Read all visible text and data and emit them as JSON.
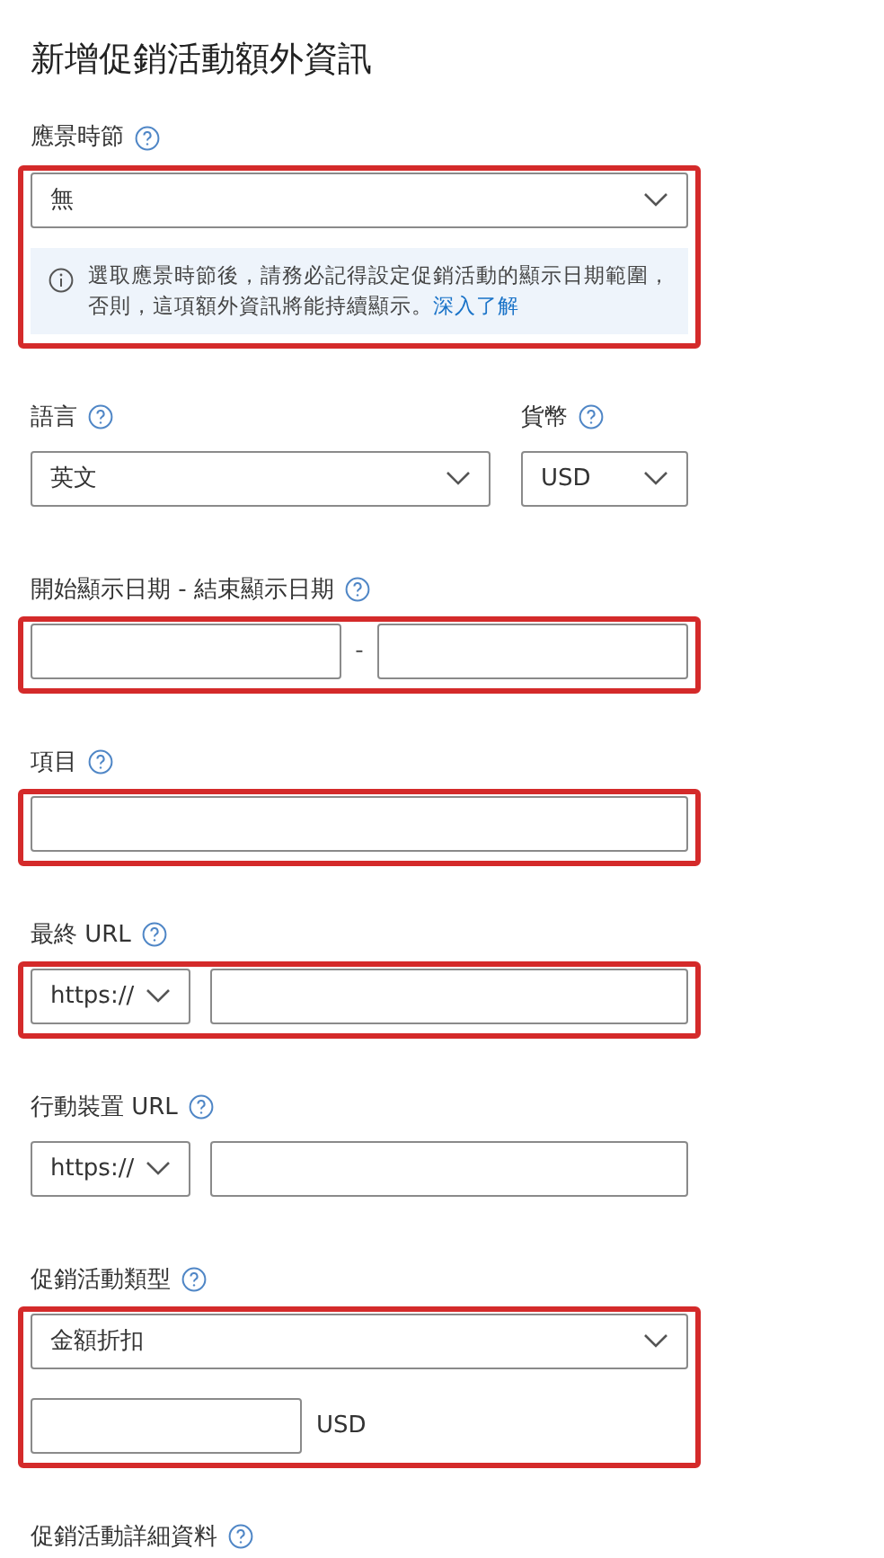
{
  "title": "新增促銷活動額外資訊",
  "groups": [
    {
      "kind": "select",
      "label": "應景時節",
      "value": "無",
      "highlighted": true,
      "note": {
        "text": "選取應景時節後，請務必記得設定促銷活動的顯示日期範圍，否則，這項額外資訊將能持續顯示。",
        "link": "深入了解"
      }
    },
    {
      "kind": "pair",
      "highlighted": false,
      "items": [
        {
          "label": "語言",
          "value": "英文"
        },
        {
          "label": "貨幣",
          "value": "USD"
        }
      ]
    },
    {
      "kind": "date-range",
      "label": "開始顯示日期 - 結束顯示日期",
      "separator": "-",
      "highlighted": true
    },
    {
      "kind": "text",
      "label": "項目",
      "highlighted": true
    },
    {
      "kind": "url",
      "label": "最終 URL",
      "protocol": "https://",
      "highlighted": true
    },
    {
      "kind": "url",
      "label": "行動裝置 URL",
      "protocol": "https://",
      "highlighted": false
    },
    {
      "kind": "select",
      "label": "促銷活動類型",
      "value": "金額折扣",
      "highlighted": true,
      "amount_unit": "USD"
    },
    {
      "kind": "heading",
      "label": "促銷活動詳細資料",
      "highlighted": false
    }
  ]
}
